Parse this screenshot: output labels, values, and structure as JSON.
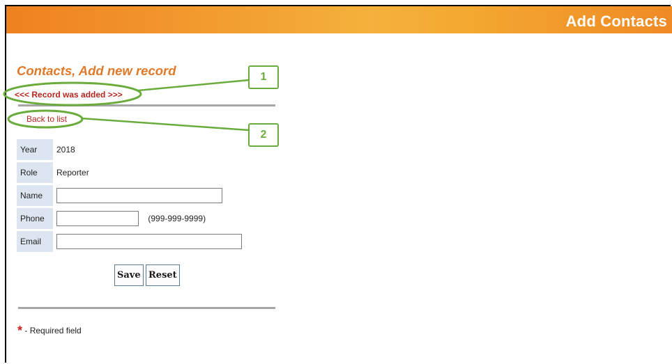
{
  "header": {
    "title": "Add Contacts"
  },
  "page": {
    "title": "Contacts, Add new record",
    "status_message": "<<< Record was added >>>",
    "back_link": "Back to list"
  },
  "form": {
    "rows": [
      {
        "label": "Year",
        "value": "2018"
      },
      {
        "label": "Role",
        "value": "Reporter"
      },
      {
        "label": "Name",
        "value": ""
      },
      {
        "label": "Phone",
        "value": "",
        "hint": "(999-999-9999)"
      },
      {
        "label": "Email",
        "value": ""
      }
    ],
    "save_label": "Save",
    "reset_label": "Reset"
  },
  "footer": {
    "required_marker": "*",
    "required_text": "- Required field"
  },
  "callouts": [
    "1",
    "2"
  ],
  "colors": {
    "accent_orange": "#e07a2a",
    "status_red": "#b5271f",
    "callout_green": "#6aac3c"
  }
}
